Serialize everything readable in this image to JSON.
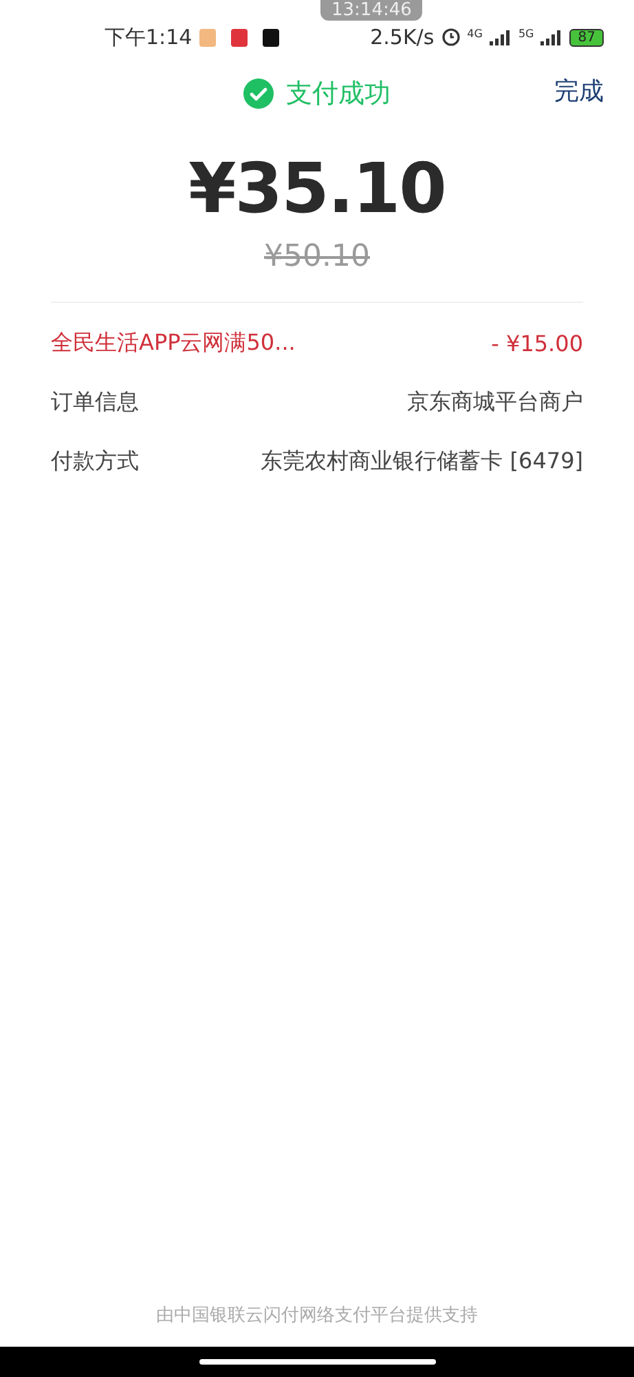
{
  "status_bar": {
    "time": "下午1:14",
    "speed": "2.5K/s",
    "network_1": "4G",
    "network_2": "5G",
    "battery": "87",
    "overlay_time": "13:14:46"
  },
  "header": {
    "title": "支付成功",
    "done": "完成"
  },
  "amount": {
    "paid": "¥35.10",
    "original": "¥50.10"
  },
  "details": [
    {
      "kind": "discount",
      "label": "全民生活APP云网满50...",
      "value": "- ¥15.00"
    },
    {
      "kind": "info",
      "label": "订单信息",
      "value": "京东商城平台商户"
    },
    {
      "kind": "info",
      "label": "付款方式",
      "value": "东莞农村商业银行储蓄卡 [6479]"
    }
  ],
  "footer": "由中国银联云闪付网络支付平台提供支持"
}
